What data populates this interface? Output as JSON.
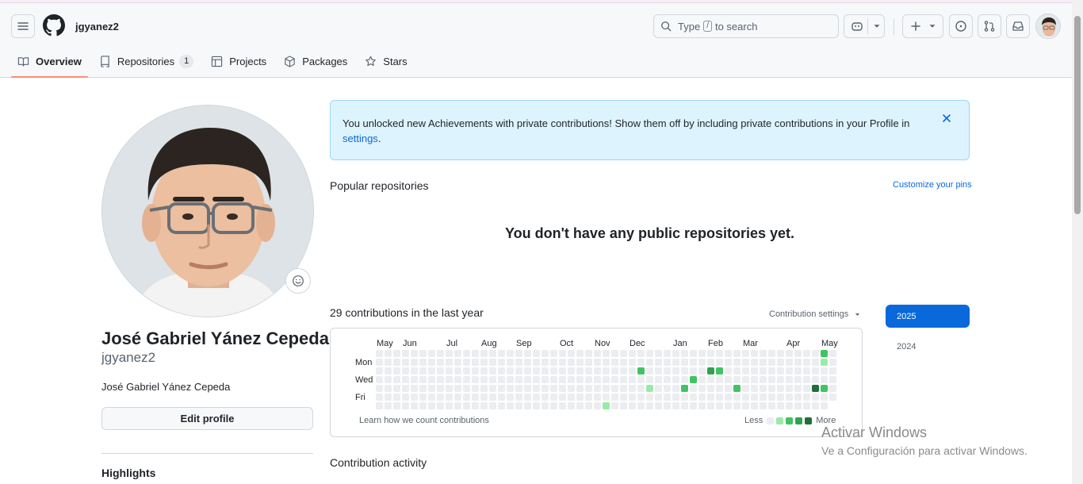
{
  "header": {
    "username": "jgyanez2",
    "search_placeholder_parts": [
      "Type",
      "/",
      "to search"
    ]
  },
  "tabs": [
    {
      "label": "Overview"
    },
    {
      "label": "Repositories",
      "count": "1"
    },
    {
      "label": "Projects"
    },
    {
      "label": "Packages"
    },
    {
      "label": "Stars"
    }
  ],
  "profile": {
    "full_name": "José Gabriel Yánez Cepeda",
    "login": "jgyanez2",
    "bio": "José Gabriel Yánez Cepeda",
    "edit_button": "Edit profile",
    "highlights": "Highlights"
  },
  "flash": {
    "text": "You unlocked new Achievements with private contributions! Show them off by including private contributions in your Profile in ",
    "link": "settings",
    "end": "."
  },
  "popular": {
    "heading": "Popular repositories",
    "customize": "Customize your pins",
    "empty": "You don't have any public repositories yet."
  },
  "contributions": {
    "heading": "29 contributions in the last year",
    "settings": "Contribution settings",
    "months": [
      "May",
      "Jun",
      "Jul",
      "Aug",
      "Sep",
      "Oct",
      "Nov",
      "Dec",
      "Jan",
      "Feb",
      "Mar",
      "Apr",
      "May"
    ],
    "days": [
      "Mon",
      "Wed",
      "Fri"
    ],
    "learn": "Learn how we count contributions",
    "less": "Less",
    "more": "More",
    "years": [
      "2025",
      "2024"
    ],
    "activity_heading": "Contribution activity",
    "levels_colors": [
      "#ebedf0",
      "#9be9a8",
      "#40c463",
      "#30a14e",
      "#216e39"
    ],
    "active_cells": [
      {
        "week": 26,
        "day": 6,
        "level": 1
      },
      {
        "week": 30,
        "day": 2,
        "level": 2
      },
      {
        "week": 31,
        "day": 4,
        "level": 1
      },
      {
        "week": 35,
        "day": 4,
        "level": 2
      },
      {
        "week": 36,
        "day": 3,
        "level": 2
      },
      {
        "week": 38,
        "day": 2,
        "level": 3
      },
      {
        "week": 39,
        "day": 2,
        "level": 2
      },
      {
        "week": 41,
        "day": 4,
        "level": 2
      },
      {
        "week": 50,
        "day": 4,
        "level": 4
      },
      {
        "week": 51,
        "day": 0,
        "level": 2
      },
      {
        "week": 51,
        "day": 1,
        "level": 1
      },
      {
        "week": 51,
        "day": 4,
        "level": 2
      }
    ]
  },
  "watermark": {
    "line1": "Activar Windows",
    "line2": "Ve a Configuración para activar Windows."
  }
}
